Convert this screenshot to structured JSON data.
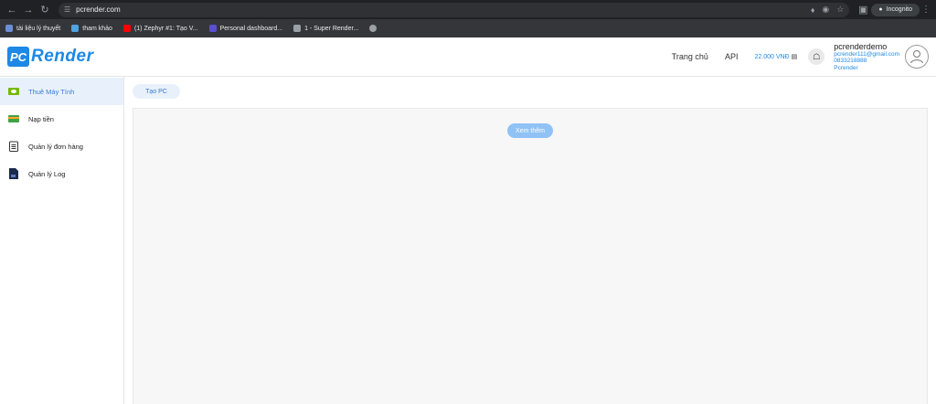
{
  "browser": {
    "url": "pcrender.com",
    "incognito_label": "Incognito",
    "bookmarks": [
      {
        "label": "tài liệu lý thuyết",
        "color": "#6b8fd4"
      },
      {
        "label": "tham khảo",
        "color": "#4fa3e0"
      },
      {
        "label": "(1) Zephyr #1: Tạo V...",
        "color": "#ff0000"
      },
      {
        "label": "Personal dashboard...",
        "color": "#5a4fcf"
      },
      {
        "label": "1 - Super Render...",
        "color": "#9aa0a6"
      }
    ]
  },
  "header": {
    "logo_box": "PC",
    "logo_text": "Render",
    "links": [
      "Trang chủ",
      "API"
    ],
    "balance": "22.000 VNĐ",
    "user": {
      "name": "pcrenderdemo",
      "email": "pcrender111@gmail.com",
      "phone": "0833218888",
      "org": "Pcrender"
    }
  },
  "sidebar": {
    "items": [
      {
        "label": "Thuê Máy Tính",
        "active": true
      },
      {
        "label": "Nạp tiền",
        "active": false
      },
      {
        "label": "Quản lý đơn hàng",
        "active": false
      },
      {
        "label": "Quản lý Log",
        "active": false
      }
    ]
  },
  "main": {
    "create_button": "Tạo PC",
    "more_button": "Xem thêm"
  },
  "colors": {
    "accent": "#1e88e5",
    "active_bg": "#e8f1fb"
  }
}
